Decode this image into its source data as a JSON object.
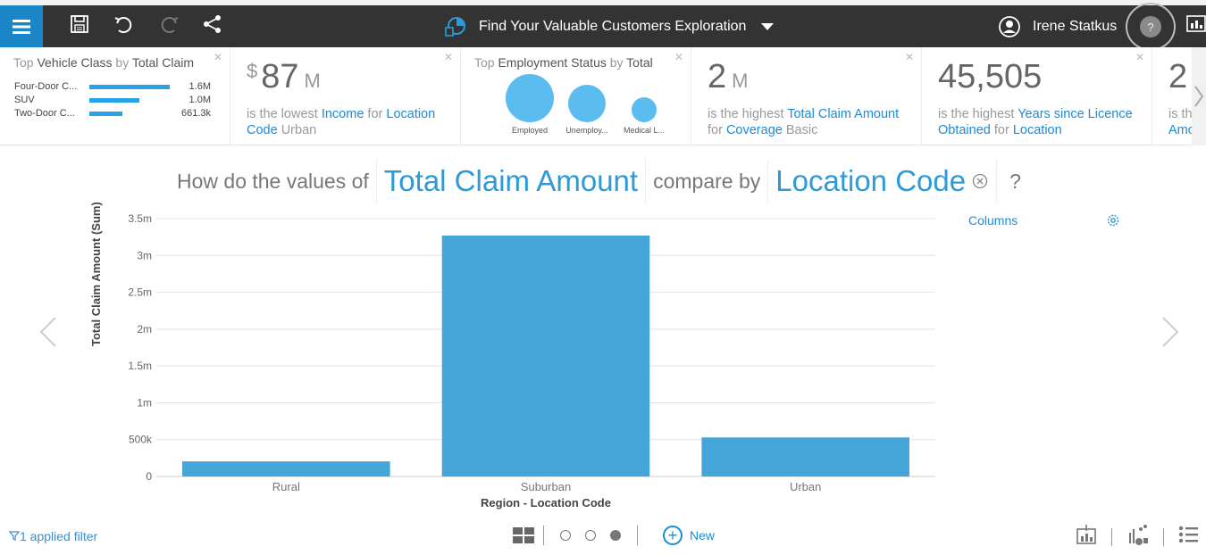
{
  "app": {
    "title": "Find Your Valuable Customers Exploration",
    "user_name": "Irene Statkus",
    "help_label": "?"
  },
  "cards": [
    {
      "kind": "bars",
      "title_prefix": "Top ",
      "title_field": "Vehicle Class",
      "title_mid": " by ",
      "title_measure": "Total Claim",
      "rows": [
        {
          "label": "Four-Door C...",
          "value": "1.6M",
          "amount": 1.6
        },
        {
          "label": "SUV",
          "value": "1.0M",
          "amount": 1.0
        },
        {
          "label": "Two-Door C...",
          "value": "661.3k",
          "amount": 0.6613
        }
      ]
    },
    {
      "kind": "kpi",
      "currency": "$",
      "value": "87",
      "unit": "M",
      "text_a": "is the lowest ",
      "link_a": "Income",
      "text_b": " for ",
      "link_b": "Location Code",
      "text_c": " Urban"
    },
    {
      "kind": "bubbles",
      "title_prefix": "Top ",
      "title_field": "Employment Status",
      "title_mid": " by ",
      "title_measure": "Total",
      "items": [
        {
          "label": "Employed",
          "size": 1.0
        },
        {
          "label": "Unemploy...",
          "size": 0.6
        },
        {
          "label": "Medical L...",
          "size": 0.27
        }
      ]
    },
    {
      "kind": "kpi",
      "currency": "",
      "value": "2",
      "unit": "M",
      "text_a": "is the highest ",
      "link_a": "Total Claim Amount",
      "text_b": " for ",
      "link_b": "Coverage",
      "text_c": " Basic"
    },
    {
      "kind": "kpi",
      "currency": "",
      "value": "45,505",
      "unit": "",
      "text_a": "is the highest ",
      "link_a": "Years since Licence Obtained",
      "text_b": " for ",
      "link_b": "Location",
      "text_c": ""
    },
    {
      "kind": "kpi-partial",
      "value": "2",
      "text_a": "is the",
      "link_a": "Amo"
    }
  ],
  "question": {
    "prefix": "How do the values of",
    "measure": "Total Claim Amount",
    "middle": "compare by",
    "dimension": "Location Code",
    "suffix": "?"
  },
  "side_panel": {
    "columns_label": "Columns"
  },
  "chart_data": {
    "type": "bar",
    "categories": [
      "Rural",
      "Suburban",
      "Urban"
    ],
    "values": [
      205000,
      3270000,
      530000
    ],
    "xlabel": "Region - Location Code",
    "ylabel": "Total Claim Amount (Sum)",
    "ylim": [
      0,
      3500000
    ],
    "yticks": [
      {
        "value": 0,
        "label": "0"
      },
      {
        "value": 500000,
        "label": "500k"
      },
      {
        "value": 1000000,
        "label": "1m"
      },
      {
        "value": 1500000,
        "label": "1.5m"
      },
      {
        "value": 2000000,
        "label": "2m"
      },
      {
        "value": 2500000,
        "label": "2.5m"
      },
      {
        "value": 3000000,
        "label": "3m"
      },
      {
        "value": 3500000,
        "label": "3.5m"
      }
    ],
    "grid": true,
    "bar_color": "#45a5d8"
  },
  "footer": {
    "filter_label": "1 applied filter",
    "new_label": "New"
  },
  "colors": {
    "accent": "#1a86c8",
    "topbar": "#333333",
    "link": "#1a8cd8"
  }
}
